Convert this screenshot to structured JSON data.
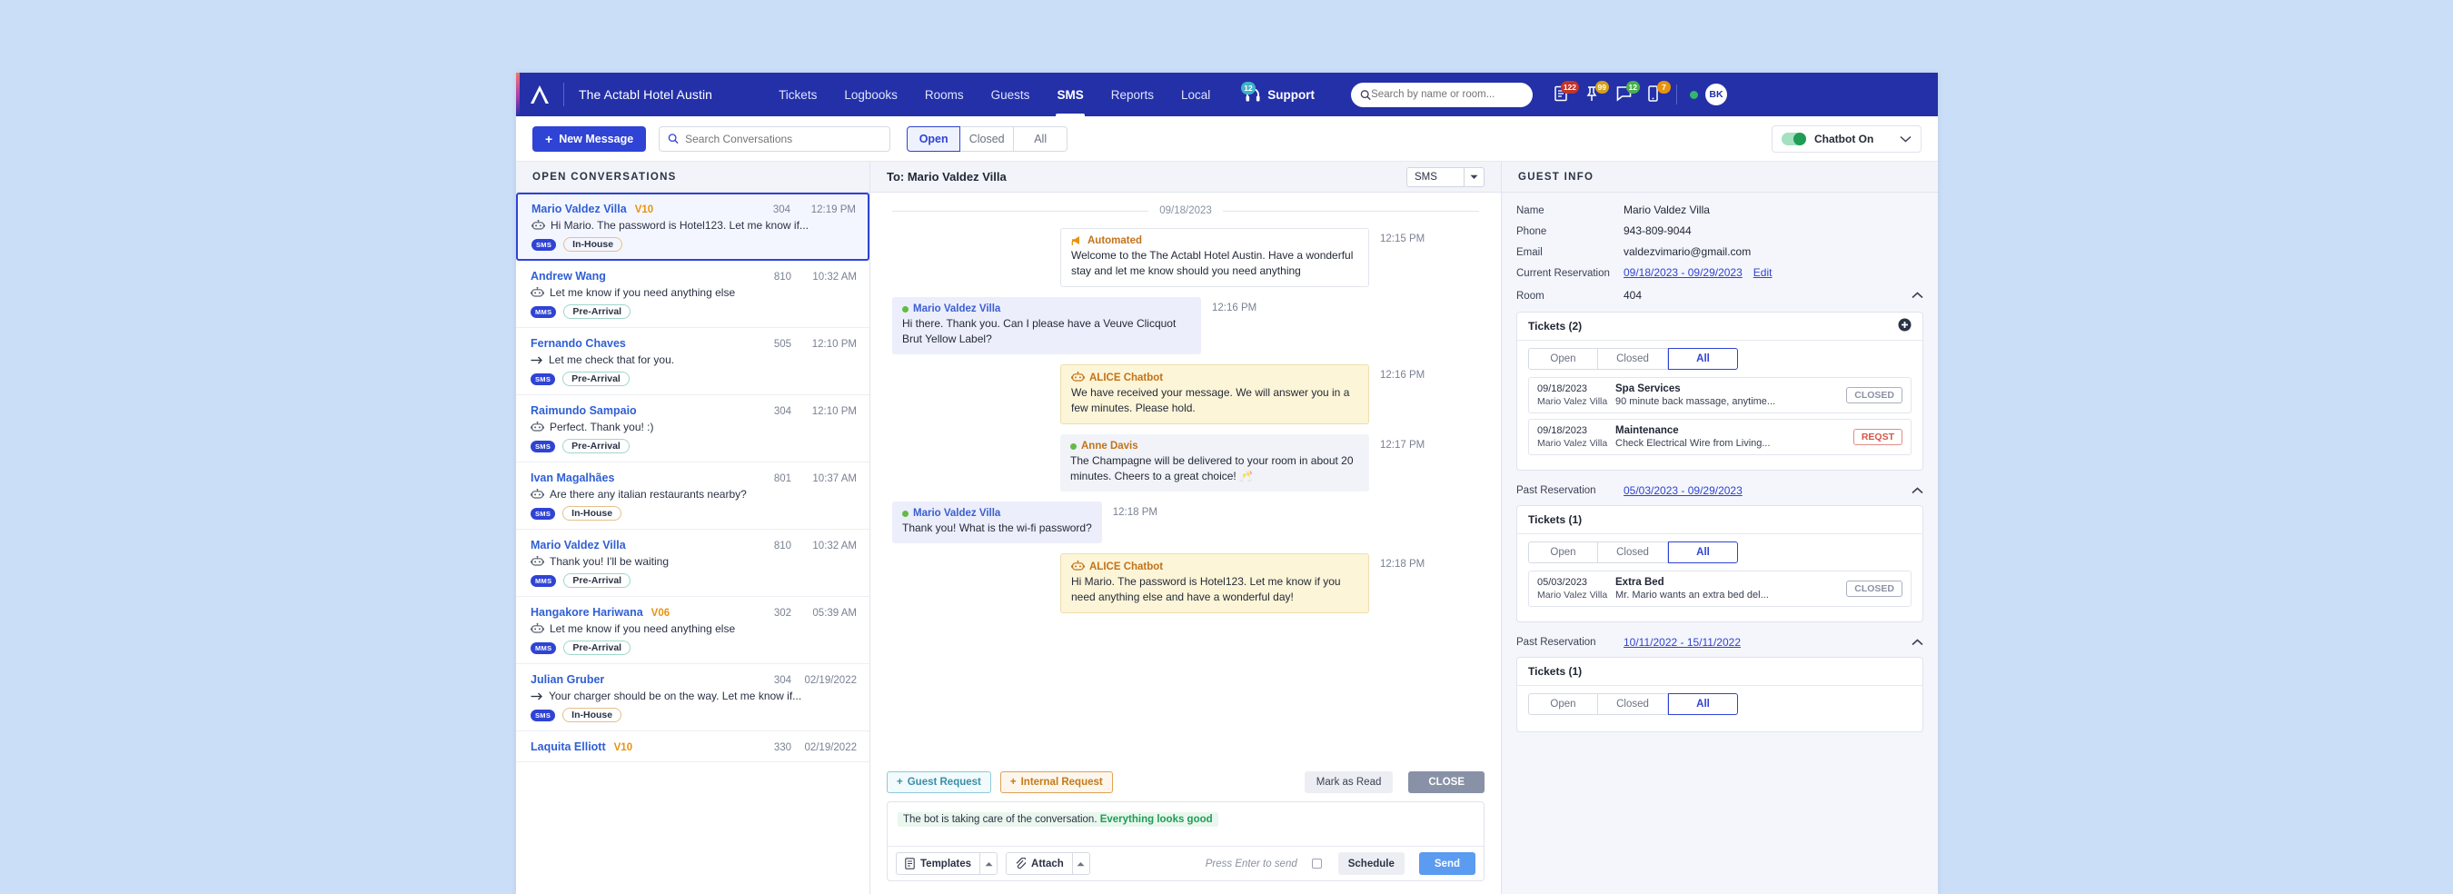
{
  "topnav": {
    "logo": "actabl-a-logo",
    "hotel_name": "The Actabl Hotel Austin",
    "links": [
      {
        "label": "Tickets",
        "active": false
      },
      {
        "label": "Logbooks",
        "active": false
      },
      {
        "label": "Rooms",
        "active": false
      },
      {
        "label": "Guests",
        "active": false
      },
      {
        "label": "SMS",
        "active": true
      },
      {
        "label": "Reports",
        "active": false
      },
      {
        "label": "Local",
        "active": false
      }
    ],
    "support": {
      "label": "Support",
      "badge": "12",
      "icon": "headset-icon"
    },
    "search_placeholder": "Search by name or room...",
    "icons": [
      {
        "name": "document-icon",
        "badge": "122",
        "badge_color": "#c4342a"
      },
      {
        "name": "pin-icon",
        "badge": "99",
        "badge_color": "#d4a017"
      },
      {
        "name": "chat-icon",
        "badge": "12",
        "badge_color": "#4caf50"
      },
      {
        "name": "mobile-icon",
        "badge": "7",
        "badge_color": "#e8930f"
      }
    ],
    "status_dot_color": "#34b56d",
    "avatar_initials": "BK"
  },
  "toolbar": {
    "new_message_label": "New Message",
    "search_placeholder": "Search Conversations",
    "filters": [
      {
        "label": "Open",
        "active": true
      },
      {
        "label": "Closed",
        "active": false
      },
      {
        "label": "All",
        "active": false
      }
    ],
    "chatbot_label": "Chatbot On",
    "chatbot_on": true
  },
  "conversations": {
    "header": "OPEN CONVERSATIONS",
    "items": [
      {
        "name": "Mario Valdez Villa",
        "vip": "V10",
        "room": "304",
        "time": "12:19 PM",
        "preview": "Hi Mario. The password is Hotel123. Let me know if...",
        "prefix_icon": "bot-icon",
        "channel": "SMS",
        "status": "In-House",
        "status_type": "inhouse",
        "selected": true
      },
      {
        "name": "Andrew Wang",
        "vip": "",
        "room": "810",
        "time": "10:32 AM",
        "preview": "Let me know if you need anything else",
        "prefix_icon": "bot-icon",
        "channel": "MMS",
        "status": "Pre-Arrival",
        "status_type": "prearrival",
        "selected": false
      },
      {
        "name": "Fernando Chaves",
        "vip": "",
        "room": "505",
        "time": "12:10 PM",
        "preview": "Let me check that for you.",
        "prefix_icon": "arrow-right-icon",
        "channel": "SMS",
        "status": "Pre-Arrival",
        "status_type": "prearrival",
        "selected": false
      },
      {
        "name": "Raimundo Sampaio",
        "vip": "",
        "room": "304",
        "time": "12:10 PM",
        "preview": "Perfect. Thank you! :)",
        "prefix_icon": "bot-icon",
        "channel": "SMS",
        "status": "Pre-Arrival",
        "status_type": "prearrival",
        "selected": false
      },
      {
        "name": "Ivan Magalhães",
        "vip": "",
        "room": "801",
        "time": "10:37 AM",
        "preview": "Are there any italian restaurants nearby?",
        "prefix_icon": "bot-icon",
        "channel": "SMS",
        "status": "In-House",
        "status_type": "inhouse",
        "selected": false
      },
      {
        "name": "Mario Valdez Villa",
        "vip": "",
        "room": "810",
        "time": "10:32 AM",
        "preview": "Thank you! I'll be waiting",
        "prefix_icon": "bot-icon",
        "channel": "MMS",
        "status": "Pre-Arrival",
        "status_type": "prearrival",
        "selected": false
      },
      {
        "name": "Hangakore Hariwana",
        "vip": "V06",
        "room": "302",
        "time": "05:39 AM",
        "preview": "Let me know if you need anything else",
        "prefix_icon": "bot-icon",
        "channel": "MMS",
        "status": "Pre-Arrival",
        "status_type": "prearrival",
        "selected": false
      },
      {
        "name": "Julian Gruber",
        "vip": "",
        "room": "304",
        "time": "02/19/2022",
        "preview": "Your charger should be on the way. Let me know if...",
        "prefix_icon": "arrow-right-icon",
        "channel": "SMS",
        "status": "In-House",
        "status_type": "inhouse",
        "selected": false
      },
      {
        "name": "Laquita Elliott",
        "vip": "V10",
        "room": "330",
        "time": "02/19/2022",
        "preview": "",
        "prefix_icon": "",
        "channel": "",
        "status": "",
        "status_type": "",
        "selected": false
      }
    ]
  },
  "chat": {
    "to_label": "To: Mario Valdez Villa",
    "channel_selected": "SMS",
    "date_divider": "09/18/2023",
    "messages": [
      {
        "sender": "Automated",
        "sender_icon": "megaphone-icon",
        "type": "automated",
        "align": "right",
        "text": "Welcome to the The Actabl Hotel Austin. Have a wonderful stay and let me know should you need anything",
        "time": "12:15 PM"
      },
      {
        "sender": "Mario Valdez Villa",
        "sender_icon": "green-dot-icon",
        "type": "guest",
        "align": "left",
        "text": "Hi there. Thank you. Can I please have a Veuve Clicquot Brut Yellow Label?",
        "time": "12:16 PM"
      },
      {
        "sender": "ALICE Chatbot",
        "sender_icon": "bot-icon",
        "type": "bot",
        "align": "right",
        "text": "We have received your message. We will answer you in a few minutes. Please hold.",
        "time": "12:16 PM"
      },
      {
        "sender": "Anne Davis",
        "sender_icon": "green-dot-icon",
        "type": "staff",
        "align": "right",
        "text": "The Champagne will be delivered to your room in about 20 minutes. Cheers to a great choice! 🥂",
        "time": "12:17 PM"
      },
      {
        "sender": "Mario Valdez Villa",
        "sender_icon": "green-dot-icon",
        "type": "guest",
        "align": "left",
        "text": "Thank you! What is the wi-fi password?",
        "time": "12:18 PM"
      },
      {
        "sender": "ALICE Chatbot",
        "sender_icon": "bot-icon",
        "type": "bot",
        "align": "right",
        "text": "Hi Mario. The password is Hotel123. Let me know if you need anything else and have a wonderful day!",
        "time": "12:18 PM"
      }
    ],
    "composer": {
      "guest_request_label": "Guest Request",
      "internal_request_label": "Internal Request",
      "mark_read_label": "Mark as Read",
      "close_label": "CLOSE",
      "bot_note_prefix": "The bot is taking care of the conversation. ",
      "bot_note_highlight": "Everything looks good",
      "templates_label": "Templates",
      "attach_label": "Attach",
      "press_enter_label": "Press Enter to send",
      "schedule_label": "Schedule",
      "send_label": "Send"
    }
  },
  "guest_info": {
    "header": "GUEST INFO",
    "fields": [
      {
        "label": "Name",
        "value": "Mario Valdez Villa",
        "link": false
      },
      {
        "label": "Phone",
        "value": "943-809-9044",
        "link": false
      },
      {
        "label": "Email",
        "value": "valdezvimario@gmail.com",
        "link": false
      },
      {
        "label": "Current Reservation",
        "value": "09/18/2023 - 09/29/2023",
        "link": true,
        "edit": "Edit"
      },
      {
        "label": "Room",
        "value": "404",
        "link": false
      }
    ],
    "sections": [
      {
        "reservation_label": "",
        "reservation_dates": "",
        "tickets_title": "Tickets (2)",
        "has_add": true,
        "tabs": [
          {
            "label": "Open",
            "active": false
          },
          {
            "label": "Closed",
            "active": false
          },
          {
            "label": "All",
            "active": true
          }
        ],
        "tickets": [
          {
            "date": "09/18/2023",
            "by": "Mario Valez Villa",
            "title": "Spa Services",
            "desc": "90 minute back massage, anytime...",
            "badge": "CLOSED",
            "badge_type": "closed"
          },
          {
            "date": "09/18/2023",
            "by": "Mario Valez Villa",
            "title": "Maintenance",
            "desc": "Check Electrical Wire from Living...",
            "badge": "REQST",
            "badge_type": "reqst"
          }
        ]
      },
      {
        "reservation_label": "Past Reservation",
        "reservation_dates": "05/03/2023 - 09/29/2023",
        "tickets_title": "Tickets (1)",
        "has_add": false,
        "tabs": [
          {
            "label": "Open",
            "active": false
          },
          {
            "label": "Closed",
            "active": false
          },
          {
            "label": "All",
            "active": true
          }
        ],
        "tickets": [
          {
            "date": "05/03/2023",
            "by": "Mario Valez Villa",
            "title": "Extra Bed",
            "desc": "Mr. Mario wants an extra bed del...",
            "badge": "CLOSED",
            "badge_type": "closed"
          }
        ]
      },
      {
        "reservation_label": "Past Reservation",
        "reservation_dates": "10/11/2022 - 15/11/2022",
        "tickets_title": "Tickets (1)",
        "has_add": false,
        "tabs": [
          {
            "label": "Open",
            "active": false
          },
          {
            "label": "Closed",
            "active": false
          },
          {
            "label": "All",
            "active": true
          }
        ],
        "tickets": []
      }
    ]
  }
}
